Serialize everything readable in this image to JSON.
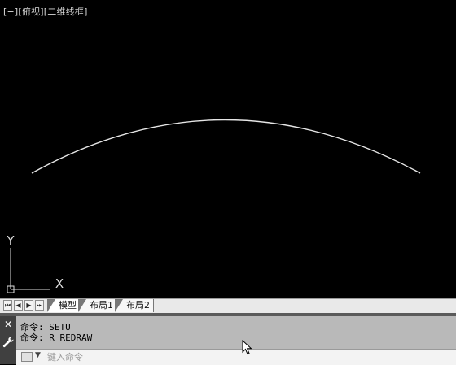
{
  "viewport": {
    "label": "[−][俯视][二维线框]",
    "ucs": {
      "y_label": "Y",
      "x_label": "X"
    }
  },
  "layout_tabs": {
    "nav_buttons": [
      "⏮",
      "◀",
      "▶",
      "⏭"
    ],
    "tabs": [
      {
        "label": "模型",
        "active": true
      },
      {
        "label": "布局1",
        "active": false
      },
      {
        "label": "布局2",
        "active": false
      }
    ]
  },
  "command_line": {
    "history": [
      "命令: SETU",
      "命令: R REDRAW"
    ],
    "input_placeholder": "键入命令",
    "close_label": "✕"
  },
  "colors": {
    "drawing_background": "#000000",
    "arc": "#e6e6e6",
    "ucs_icon": "#dddddd"
  }
}
